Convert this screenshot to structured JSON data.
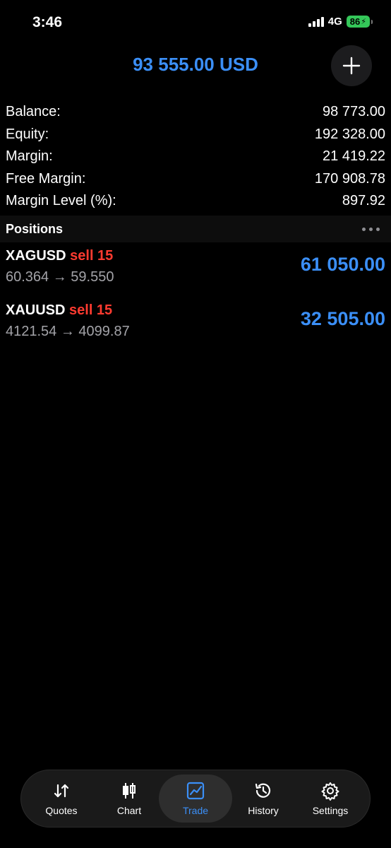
{
  "status_bar": {
    "time": "3:46",
    "network": "4G",
    "battery": "86"
  },
  "header": {
    "title": "93 555.00 USD"
  },
  "summary": [
    {
      "label": "Balance:",
      "value": "98 773.00"
    },
    {
      "label": "Equity:",
      "value": "192 328.00"
    },
    {
      "label": "Margin:",
      "value": "21 419.22"
    },
    {
      "label": "Free Margin:",
      "value": "170 908.78"
    },
    {
      "label": "Margin Level (%):",
      "value": "897.92"
    }
  ],
  "positions_header": "Positions",
  "positions": [
    {
      "symbol": "XAGUSD",
      "side": "sell 15",
      "prices": "60.364 → 59.550",
      "profit": "61 050.00"
    },
    {
      "symbol": "XAUUSD",
      "side": "sell 15",
      "prices": "4121.54 → 4099.87",
      "profit": "32 505.00"
    }
  ],
  "tabs": [
    {
      "label": "Quotes",
      "icon": "quotes-arrows-icon"
    },
    {
      "label": "Chart",
      "icon": "candlestick-icon"
    },
    {
      "label": "Trade",
      "icon": "trade-chart-icon",
      "active": true
    },
    {
      "label": "History",
      "icon": "history-clock-icon"
    },
    {
      "label": "Settings",
      "icon": "gear-icon"
    }
  ],
  "colors": {
    "accent": "#3b8ff7",
    "sell": "#ff3b30",
    "battery": "#34c759"
  }
}
